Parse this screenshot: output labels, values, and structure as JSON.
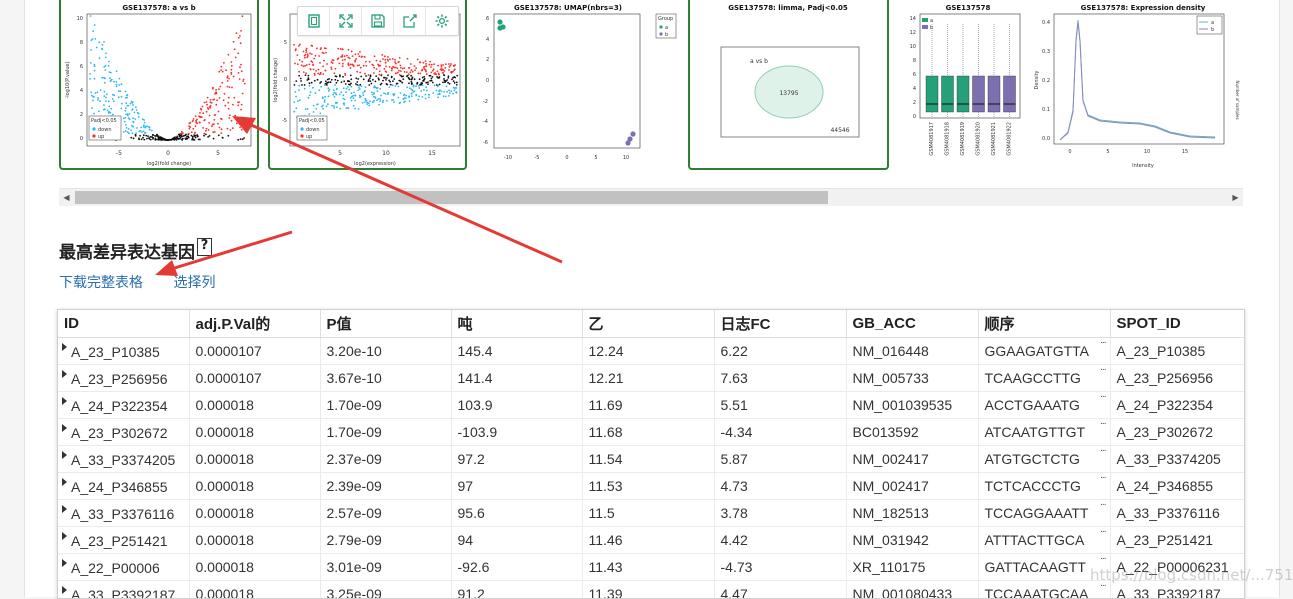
{
  "plots": {
    "volcano": {
      "title": "GSE137578: a vs b",
      "xlabel": "log2(fold change)",
      "ylabel": "-log10(P.value)",
      "xticks": [
        "-5",
        "0",
        "5"
      ],
      "yticks": [
        "0",
        "2",
        "4",
        "6",
        "8",
        "10"
      ],
      "legend_title": "Padj<0.05",
      "legend": [
        "down",
        "up"
      ]
    },
    "md": {
      "xlabel": "log2(expression)",
      "ylabel": "log2(fold change)",
      "xticks": [
        "5",
        "10",
        "15"
      ],
      "yticks": [
        "-5",
        "0",
        "5"
      ],
      "legend_title": "Padj<0.05",
      "legend": [
        "down",
        "up"
      ]
    },
    "umap": {
      "title": "GSE137578: UMAP(nbrs=3)",
      "xticks": [
        "-10",
        "-5",
        "0",
        "5",
        "10"
      ],
      "yticks": [
        "6",
        "4",
        "2",
        "0",
        "-2",
        "-4",
        "-6"
      ],
      "legend_title": "Group",
      "legend": [
        "a",
        "b"
      ]
    },
    "venn": {
      "title": "GSE137578: limma, Padj<0.05",
      "label": "a vs b",
      "inside": "13795",
      "outside": "44546"
    },
    "boxplot": {
      "title": "GSE137578",
      "legend": [
        "a",
        "b"
      ],
      "yticks": [
        "0",
        "2",
        "4",
        "6",
        "8",
        "10",
        "12",
        "14"
      ],
      "samples": [
        "GSM4081917",
        "GSM4081918",
        "GSM4081919",
        "GSM4081920",
        "GSM4081921",
        "GSM4081922"
      ]
    },
    "density": {
      "title": "GSE137578: Expression density",
      "xlabel": "Intensity",
      "ylabel": "Density",
      "xticks": [
        "0",
        "5",
        "10",
        "15"
      ],
      "yticks": [
        "0.0",
        "0.1",
        "0.2",
        "0.3",
        "0.4"
      ],
      "legend": [
        "a",
        "b"
      ],
      "side_label": "Number of samples"
    }
  },
  "toolbar": {
    "icons": [
      "maximize-icon",
      "fullscreen-icon",
      "save-icon",
      "share-icon",
      "gear-icon"
    ]
  },
  "section": {
    "title": "最高差异表达基因",
    "help": "?"
  },
  "links": {
    "download": "下载完整表格",
    "columns": "选择列"
  },
  "table": {
    "headers": [
      "ID",
      "adj.P.Val的",
      "P值",
      "吨",
      "乙",
      "日志FC",
      "GB_ACC",
      "顺序",
      "SPOT_ID"
    ],
    "rows": [
      [
        "A_23_P10385",
        "0.0000107",
        "3.20e-10",
        "145.4",
        "12.24",
        "6.22",
        "NM_016448",
        "GGAAGATGTTA",
        "A_23_P10385"
      ],
      [
        "A_23_P256956",
        "0.0000107",
        "3.67e-10",
        "141.4",
        "12.21",
        "7.63",
        "NM_005733",
        "TCAAGCCTTG",
        "A_23_P256956"
      ],
      [
        "A_24_P322354",
        "0.000018",
        "1.70e-09",
        "103.9",
        "11.69",
        "5.51",
        "NM_001039535",
        "ACCTGAAATG",
        "A_24_P322354"
      ],
      [
        "A_23_P302672",
        "0.000018",
        "1.70e-09",
        "-103.9",
        "11.68",
        "-4.34",
        "BC013592",
        "ATCAATGTTGT",
        "A_23_P302672"
      ],
      [
        "A_33_P3374205",
        "0.000018",
        "2.37e-09",
        "97.2",
        "11.54",
        "5.87",
        "NM_002417",
        "ATGTGCTCTG",
        "A_33_P3374205"
      ],
      [
        "A_24_P346855",
        "0.000018",
        "2.39e-09",
        "97",
        "11.53",
        "4.73",
        "NM_002417",
        "TCTCACCCTG",
        "A_24_P346855"
      ],
      [
        "A_33_P3376116",
        "0.000018",
        "2.57e-09",
        "95.6",
        "11.5",
        "3.78",
        "NM_182513",
        "TCCAGGAAATT",
        "A_33_P3376116"
      ],
      [
        "A_23_P251421",
        "0.000018",
        "2.79e-09",
        "94",
        "11.46",
        "4.42",
        "NM_031942",
        "ATTTACTTGCA",
        "A_23_P251421"
      ],
      [
        "A_22_P00006",
        "0.000018",
        "3.01e-09",
        "-92.6",
        "11.43",
        "-4.73",
        "XR_110175",
        "GATTACAAGTT",
        "A_22_P00006231"
      ],
      [
        "A_33_P3392187",
        "0.000018",
        "3.25e-09",
        "91.2",
        "11.39",
        "4.47",
        "NM_001080433",
        "TCCAAATGCAA",
        "A_33_P3392187"
      ]
    ]
  },
  "watermark": "https://blog.csdn.net/...751227",
  "colors": {
    "up": "#ff2a2a",
    "down": "#29b6f6",
    "ns": "#111111",
    "group_a": "#26a07a",
    "group_b": "#7e6fb0",
    "selected_border": "#2e7d32",
    "link": "#2a6db0",
    "annotation": "#e53935"
  }
}
